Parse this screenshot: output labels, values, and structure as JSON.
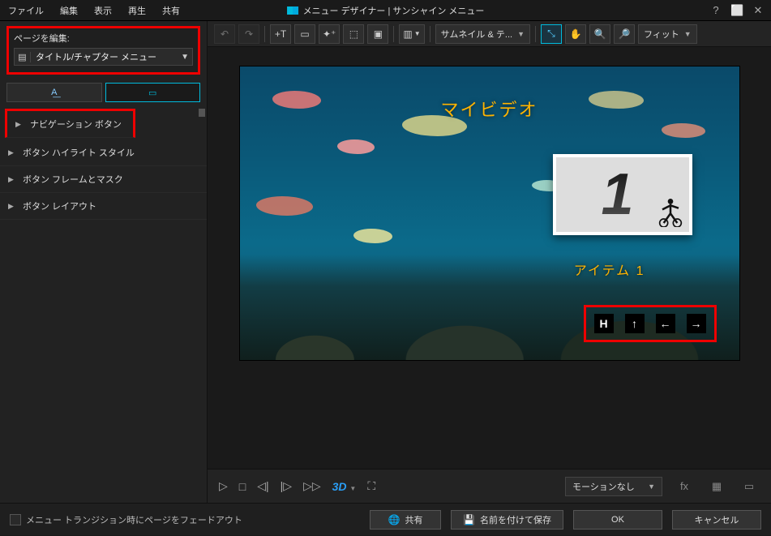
{
  "menu": {
    "items": [
      "ファイル",
      "編集",
      "表示",
      "再生",
      "共有"
    ]
  },
  "app_title": "メニュー デザイナー | サンシャイン メニュー",
  "win": {
    "help": "?",
    "min": "⬜",
    "close": "✕"
  },
  "left": {
    "edit_page_label": "ページを編集:",
    "page_select": "タイトル/チャプター メニュー",
    "tree": [
      "ナビゲーション ボタン",
      "ボタン ハイライト スタイル",
      "ボタン フレームとマスク",
      "ボタン レイアウト"
    ]
  },
  "toolbar": {
    "thumb_text_label": "サムネイル & テ...",
    "fit_label": "フィット"
  },
  "canvas": {
    "title": "マイビデオ",
    "item_label": "アイテム 1",
    "nav": {
      "home": "H",
      "up": "↑",
      "left": "←",
      "right": "→"
    }
  },
  "playback": {
    "threeD": "3D",
    "motion_label": "モーションなし",
    "fx": "fx"
  },
  "footer": {
    "fade_label": "メニュー トランジション時にページをフェードアウト",
    "share": "共有",
    "save_as": "名前を付けて保存",
    "ok": "OK",
    "cancel": "キャンセル"
  }
}
